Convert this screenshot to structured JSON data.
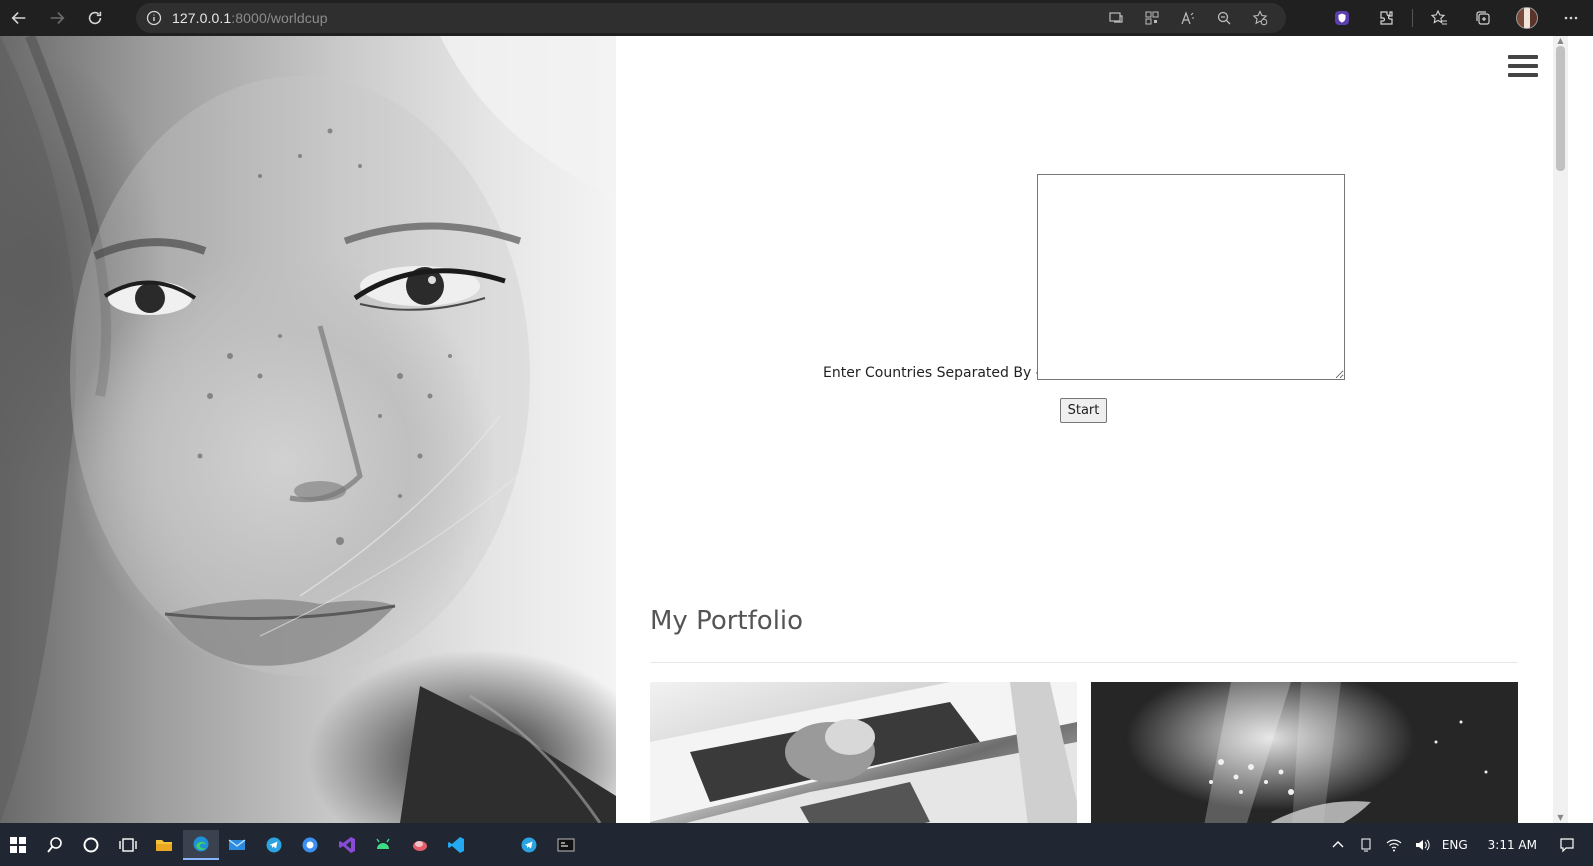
{
  "browser": {
    "url_host": "127.0.0.1",
    "url_path": ":8000/worldcup"
  },
  "form": {
    "label": "Enter Countries Separated By - :",
    "textarea_value": "",
    "start_label": "Start"
  },
  "portfolio": {
    "title": "My Portfolio"
  },
  "taskbar": {
    "language": "ENG",
    "time": "3:11 AM"
  }
}
